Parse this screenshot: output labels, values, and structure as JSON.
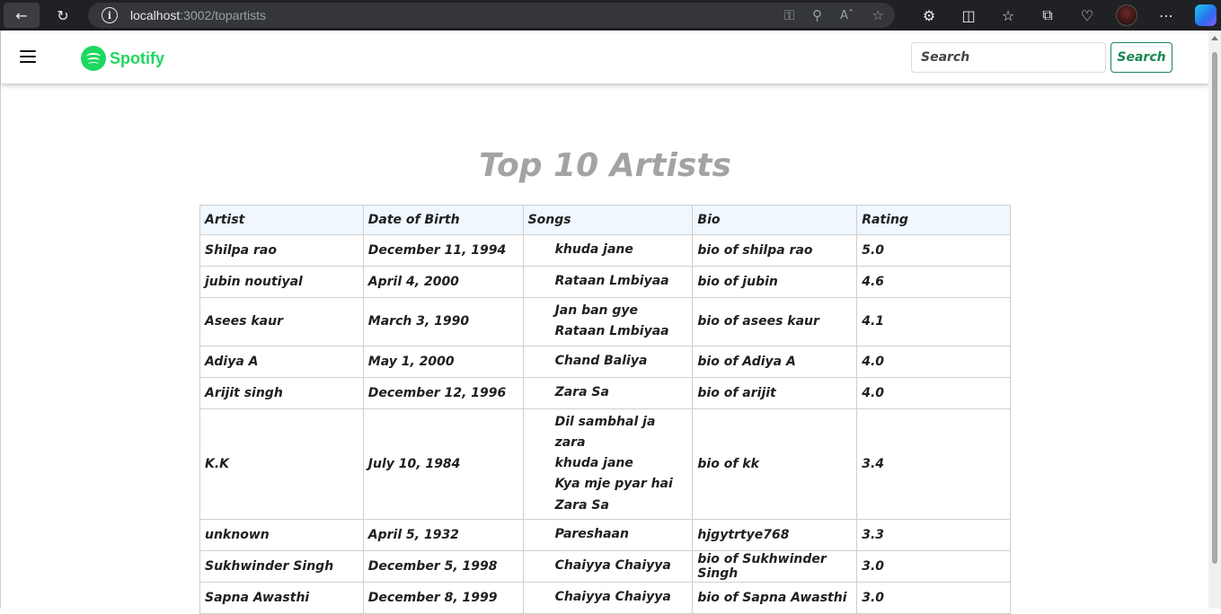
{
  "browser": {
    "url_host": "localhost",
    "url_path": ":3002/topartists"
  },
  "navbar": {
    "brand": "Spotify",
    "search_placeholder": "Search",
    "search_button": "Search"
  },
  "page": {
    "title": "Top 10 Artists"
  },
  "table": {
    "headers": [
      "Artist",
      "Date of Birth",
      "Songs",
      "Bio",
      "Rating"
    ],
    "rows": [
      {
        "artist": "Shilpa rao",
        "dob": "December 11, 1994",
        "songs": [
          "khuda jane"
        ],
        "bio": "bio of shilpa rao",
        "rating": "5.0"
      },
      {
        "artist": "jubin noutiyal",
        "dob": "April 4, 2000",
        "songs": [
          "Rataan Lmbiyaa"
        ],
        "bio": "bio of jubin",
        "rating": "4.6"
      },
      {
        "artist": "Asees kaur",
        "dob": "March 3, 1990",
        "songs": [
          "Jan ban gye",
          "Rataan Lmbiyaa"
        ],
        "bio": "bio of asees kaur",
        "rating": "4.1"
      },
      {
        "artist": "Adiya A",
        "dob": "May 1, 2000",
        "songs": [
          "Chand Baliya"
        ],
        "bio": "bio of Adiya A",
        "rating": "4.0"
      },
      {
        "artist": "Arijit singh",
        "dob": "December 12, 1996",
        "songs": [
          "Zara Sa"
        ],
        "bio": "bio of arijit",
        "rating": "4.0"
      },
      {
        "artist": "K.K",
        "dob": "July 10, 1984",
        "songs": [
          "Dil sambhal ja zara",
          "khuda jane",
          "Kya mje pyar hai",
          "Zara Sa"
        ],
        "bio": "bio of kk",
        "rating": "3.4"
      },
      {
        "artist": "unknown",
        "dob": "April 5, 1932",
        "songs": [
          "Pareshaan"
        ],
        "bio": "hjgytrtye768",
        "rating": "3.3"
      },
      {
        "artist": "Sukhwinder Singh",
        "dob": "December 5, 1998",
        "songs": [
          "Chaiyya Chaiyya"
        ],
        "bio": "bio of Sukhwinder Singh",
        "rating": "3.0"
      },
      {
        "artist": "Sapna Awasthi",
        "dob": "December 8, 1999",
        "songs": [
          "Chaiyya Chaiyya"
        ],
        "bio": "bio of Sapna Awasthi",
        "rating": "3.0"
      }
    ]
  },
  "colors": {
    "brand_green": "#1ed760",
    "button_green": "#198754",
    "header_bg": "#f0f7fe",
    "title_gray": "#a3a3a3"
  },
  "icons": [
    "back-icon",
    "reload-icon",
    "info-icon",
    "key-icon",
    "zoom-out-icon",
    "read-aloud-icon",
    "favorite-star-icon",
    "extensions-icon",
    "split-screen-icon",
    "favorites-icon",
    "collections-icon",
    "health-icon",
    "profile-avatar",
    "more-icon",
    "copilot-icon",
    "hamburger-icon",
    "spotify-logo-icon"
  ]
}
